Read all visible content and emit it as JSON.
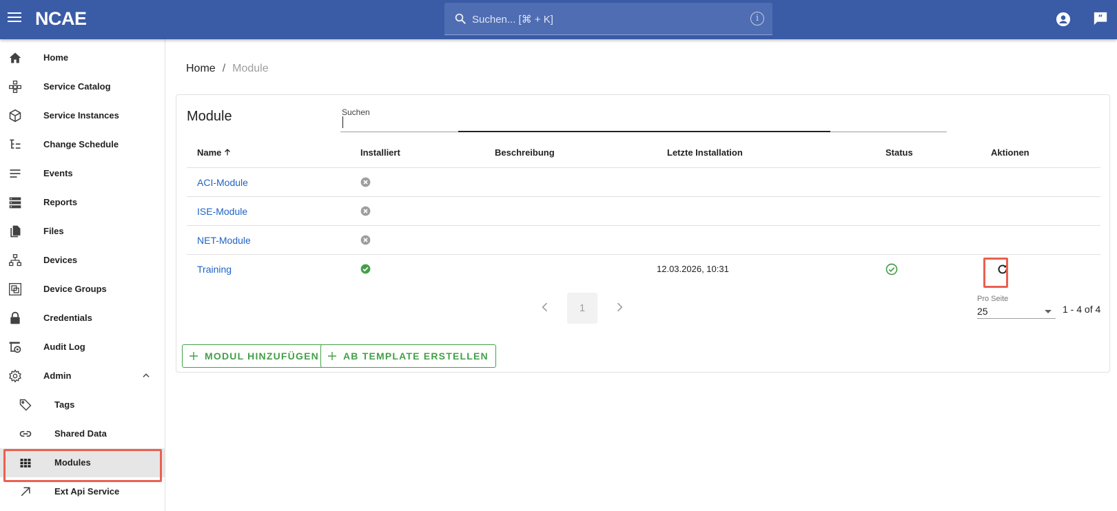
{
  "topbar": {
    "logo": "NCAE",
    "search_placeholder": "Suchen... [⌘ + K]",
    "info_glyph": "i",
    "icons": [
      "menu-icon",
      "search-icon",
      "info-icon",
      "account-icon",
      "feedback-icon"
    ],
    "color": "#3a5ba6"
  },
  "sidebar": {
    "items": [
      {
        "label": "Home",
        "icon": "home-icon"
      },
      {
        "label": "Service Catalog",
        "icon": "service-catalog-icon"
      },
      {
        "label": "Service Instances",
        "icon": "cube-icon"
      },
      {
        "label": "Change Schedule",
        "icon": "schedule-tree-icon"
      },
      {
        "label": "Events",
        "icon": "events-list-icon"
      },
      {
        "label": "Reports",
        "icon": "reports-icon"
      },
      {
        "label": "Files",
        "icon": "files-icon"
      },
      {
        "label": "Devices",
        "icon": "devices-network-icon"
      },
      {
        "label": "Device Groups",
        "icon": "device-groups-icon"
      },
      {
        "label": "Credentials",
        "icon": "lock-icon"
      },
      {
        "label": "Audit Log",
        "icon": "audit-log-icon"
      },
      {
        "label": "Admin",
        "icon": "gear-icon"
      },
      {
        "label": "Tags",
        "icon": "tag-icon"
      },
      {
        "label": "Shared Data",
        "icon": "link-icon"
      },
      {
        "label": "Modules",
        "icon": "grid-icon"
      },
      {
        "label": "Ext Api Service",
        "icon": "arrow-up-right-icon"
      }
    ],
    "active": "Modules"
  },
  "breadcrumb": {
    "home": "Home",
    "separator": "/",
    "current": "Module"
  },
  "card": {
    "title": "Module",
    "search_label": "Suchen",
    "columns": {
      "name": "Name",
      "installed": "Installiert",
      "description": "Beschreibung",
      "last_install": "Letzte Installation",
      "status": "Status",
      "actions": "Aktionen"
    },
    "rows": [
      {
        "name": "ACI-Module",
        "installed": false,
        "description": "",
        "last_install": "",
        "status": ""
      },
      {
        "name": "ISE-Module",
        "installed": false,
        "description": "",
        "last_install": "",
        "status": ""
      },
      {
        "name": "NET-Module",
        "installed": false,
        "description": "",
        "last_install": "",
        "status": ""
      },
      {
        "name": "Training",
        "installed": true,
        "description": "",
        "last_install": "12.03.2026, 10:31",
        "status": "ok",
        "action_icon": "refresh-icon"
      }
    ],
    "pagination": {
      "page": "1",
      "per_page_label": "Pro Seite",
      "per_page": "25",
      "range": "1 - 4 of 4"
    },
    "buttons": {
      "add_module": "MODUL HINZUFÜGEN",
      "from_template": "AB TEMPLATE ERSTELLEN"
    }
  },
  "colors": {
    "accent_green": "#43a047",
    "link_blue": "#1e63c4",
    "highlight_red": "#ec5f4f"
  }
}
